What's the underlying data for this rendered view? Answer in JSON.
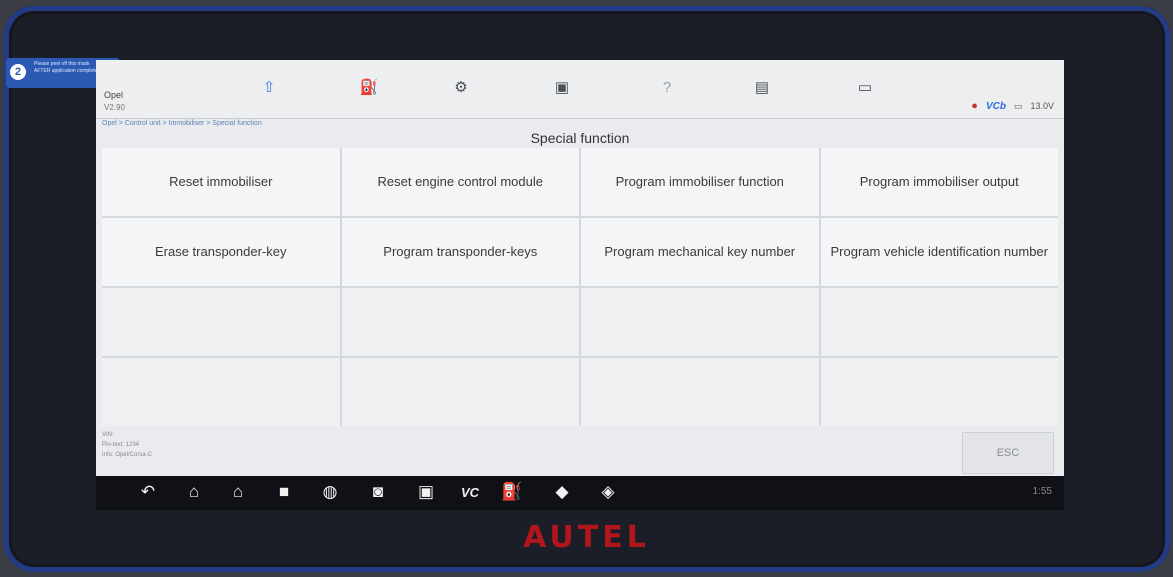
{
  "sticker": {
    "number": "2",
    "line1": "Please peel off this mask",
    "line2": "AFTER application completed"
  },
  "header": {
    "app_name": "Opel",
    "app_version": "V2.90",
    "toolbar_icons": [
      "car-home-icon",
      "vehicle-lift-icon",
      "settings-gear-icon",
      "printer-icon",
      "help-icon",
      "save-icon",
      "chat-icon"
    ],
    "status": {
      "vc_label": "VCb",
      "battery_voltage": "13.0V"
    }
  },
  "breadcrumb": "Opel > Control unit > Immobiliser > Special function",
  "section_title": "Special function",
  "functions": [
    "Reset immobiliser",
    "Reset engine control module",
    "Program immobiliser function",
    "Program immobiliser output",
    "Erase transponder-key",
    "Program transponder-keys",
    "Program mechanical key number",
    "Program vehicle identification number"
  ],
  "footer": {
    "vin_label": "VIN:",
    "pin_label": "Pin-text: 1234",
    "info_label": "Info: Opel/Corsa-C",
    "esc_label": "ESC"
  },
  "navbar": {
    "icons": [
      "back-icon",
      "home-icon",
      "car-garage-icon",
      "recent-apps-icon",
      "browser-icon",
      "camera-icon",
      "screen-record-icon",
      "vci-icon",
      "fuel-icon",
      "car-service-icon",
      "car-remote-icon"
    ],
    "vc_label": "VC",
    "time": "1:55"
  },
  "brand": "AUTEL"
}
